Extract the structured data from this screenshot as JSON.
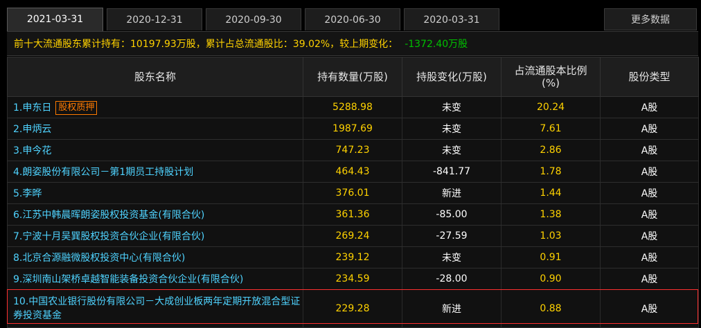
{
  "tabs": [
    {
      "label": "2021-03-31",
      "active": true
    },
    {
      "label": "2020-12-31",
      "active": false
    },
    {
      "label": "2020-09-30",
      "active": false
    },
    {
      "label": "2020-06-30",
      "active": false
    },
    {
      "label": "2020-03-31",
      "active": false
    }
  ],
  "more_button": "更多数据",
  "summary": {
    "text": "前十大流通股东累计持有：10197.93万股，累计占总流通股比：39.02%，较上期变化：",
    "change": "-1372.40万股"
  },
  "table": {
    "headers": {
      "name": "股东名称",
      "holding": "持有数量(万股)",
      "change": "持股变化(万股)",
      "ratio_line1": "占流通股本比例",
      "ratio_line2": "(%)",
      "type": "股份类型"
    },
    "rows": [
      {
        "name": "1.申东日",
        "tag": "股权质押",
        "holding": "5288.98",
        "change": "未变",
        "change_kind": "unchanged",
        "ratio": "20.24",
        "type": "A股"
      },
      {
        "name": "2.申炳云",
        "tag": "",
        "holding": "1987.69",
        "change": "未变",
        "change_kind": "unchanged",
        "ratio": "7.61",
        "type": "A股"
      },
      {
        "name": "3.申今花",
        "tag": "",
        "holding": "747.23",
        "change": "未变",
        "change_kind": "unchanged",
        "ratio": "2.86",
        "type": "A股"
      },
      {
        "name": "4.朗姿股份有限公司－第1期员工持股计划",
        "tag": "",
        "holding": "464.43",
        "change": "-841.77",
        "change_kind": "neg",
        "ratio": "1.78",
        "type": "A股"
      },
      {
        "name": "5.李晔",
        "tag": "",
        "holding": "376.01",
        "change": "新进",
        "change_kind": "new",
        "ratio": "1.44",
        "type": "A股"
      },
      {
        "name": "6.江苏中韩晨晖朗姿股权投资基金(有限合伙)",
        "tag": "",
        "holding": "361.36",
        "change": "-85.00",
        "change_kind": "neg",
        "ratio": "1.38",
        "type": "A股"
      },
      {
        "name": "7.宁波十月吴巽股权投资合伙企业(有限合伙)",
        "tag": "",
        "holding": "269.24",
        "change": "-27.59",
        "change_kind": "neg",
        "ratio": "1.03",
        "type": "A股"
      },
      {
        "name": "8.北京合源融微股权投资中心(有限合伙)",
        "tag": "",
        "holding": "239.12",
        "change": "未变",
        "change_kind": "unchanged",
        "ratio": "0.91",
        "type": "A股"
      },
      {
        "name": "9.深圳南山架桥卓越智能装备投资合伙企业(有限合伙)",
        "tag": "",
        "holding": "234.59",
        "change": "-28.00",
        "change_kind": "neg",
        "ratio": "0.90",
        "type": "A股"
      },
      {
        "name": "10.中国农业银行股份有限公司－大成创业板两年定期开放混合型证券投资基金",
        "tag": "",
        "holding": "229.28",
        "change": "新进",
        "change_kind": "new",
        "ratio": "0.88",
        "type": "A股"
      }
    ]
  },
  "colors": {
    "background": "#000000",
    "name_text": "#4fd3ff",
    "number_text": "#ffd200",
    "negative": "#00c000",
    "new": "#ff2d2d",
    "tag": "#ff7a00",
    "highlight": "#ff3030"
  }
}
